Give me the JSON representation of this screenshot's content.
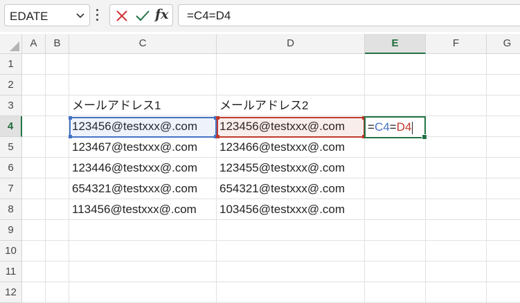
{
  "name_box": {
    "value": "EDATE"
  },
  "formula_bar": {
    "fx_label": "fx",
    "value": "=C4=D4"
  },
  "columns": [
    "A",
    "B",
    "C",
    "D",
    "E",
    "F",
    "G"
  ],
  "rows": [
    "1",
    "2",
    "3",
    "4",
    "5",
    "6",
    "7",
    "8",
    "9",
    "10",
    "11",
    "12"
  ],
  "active_cell": {
    "ref": "E4",
    "column": "E",
    "row": "4",
    "edit": {
      "eq1": "=",
      "ref1": "C4",
      "eq2": "=",
      "ref2": "D4"
    }
  },
  "cells": {
    "C3": "メールアドレス1",
    "D3": "メールアドレス2",
    "C4": "123456@testxxx@.com",
    "D4": "123456@testxxx@.com",
    "C5": "123467@testxxx@.com",
    "D5": "123466@testxxx@.com",
    "C6": "123446@testxxx@.com",
    "D6": "123455@testxxx@.com",
    "C7": "654321@testxxx@.com",
    "D7": "654321@testxxx@.com",
    "C8": "113456@testxxx@.com",
    "D8": "103456@testxxx@.com"
  },
  "colors": {
    "accent_green": "#217346",
    "ref_blue": "#4472c4",
    "ref_red": "#c0392b"
  }
}
